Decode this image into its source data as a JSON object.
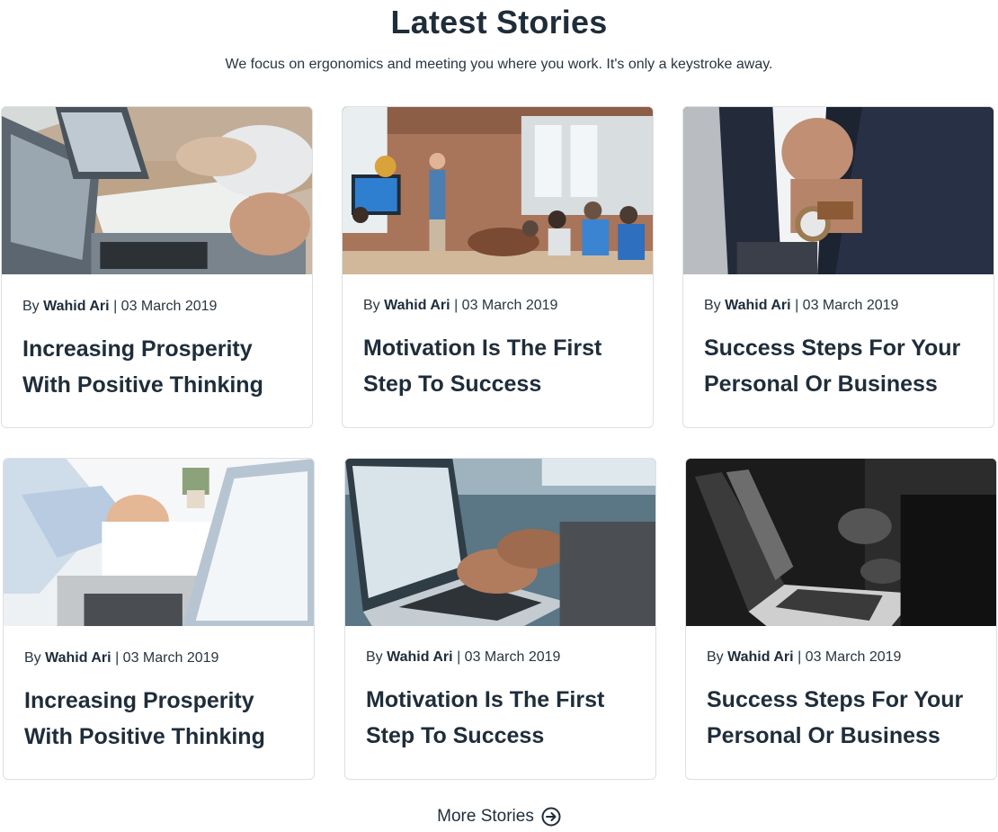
{
  "header": {
    "title": "Latest Stories",
    "subtitle": "We focus on ergonomics and meeting you where you work. It's only a keystroke away."
  },
  "cards": [
    {
      "by": "By",
      "author": "Wahid Ari",
      "separator": "|",
      "date": "03 March 2019",
      "title": "Increasing Prosperity With Positive Thinking",
      "image": "office-desk-photo"
    },
    {
      "by": "By",
      "author": "Wahid Ari",
      "separator": "|",
      "date": "03 March 2019",
      "title": "Motivation Is The First Step To Success",
      "image": "conference-presentation-photo"
    },
    {
      "by": "By",
      "author": "Wahid Ari",
      "separator": "|",
      "date": "03 March 2019",
      "title": "Success Steps For Your Personal Or Business",
      "image": "businessman-watch-photo"
    },
    {
      "by": "By",
      "author": "Wahid Ari",
      "separator": "|",
      "date": "03 March 2019",
      "title": "Increasing Prosperity With Positive Thinking",
      "image": "laptop-notebook-photo"
    },
    {
      "by": "By",
      "author": "Wahid Ari",
      "separator": "|",
      "date": "03 March 2019",
      "title": "Motivation Is The First Step To Success",
      "image": "typing-laptop-photo"
    },
    {
      "by": "By",
      "author": "Wahid Ari",
      "separator": "|",
      "date": "03 March 2019",
      "title": "Success Steps For Your Personal Or Business",
      "image": "monochrome-laptop-photo"
    }
  ],
  "footer": {
    "more_label": "More Stories",
    "more_icon": "arrow-right-circle-icon"
  },
  "colors": {
    "text_dark": "#1f2d3a",
    "border": "#dde0e3"
  }
}
